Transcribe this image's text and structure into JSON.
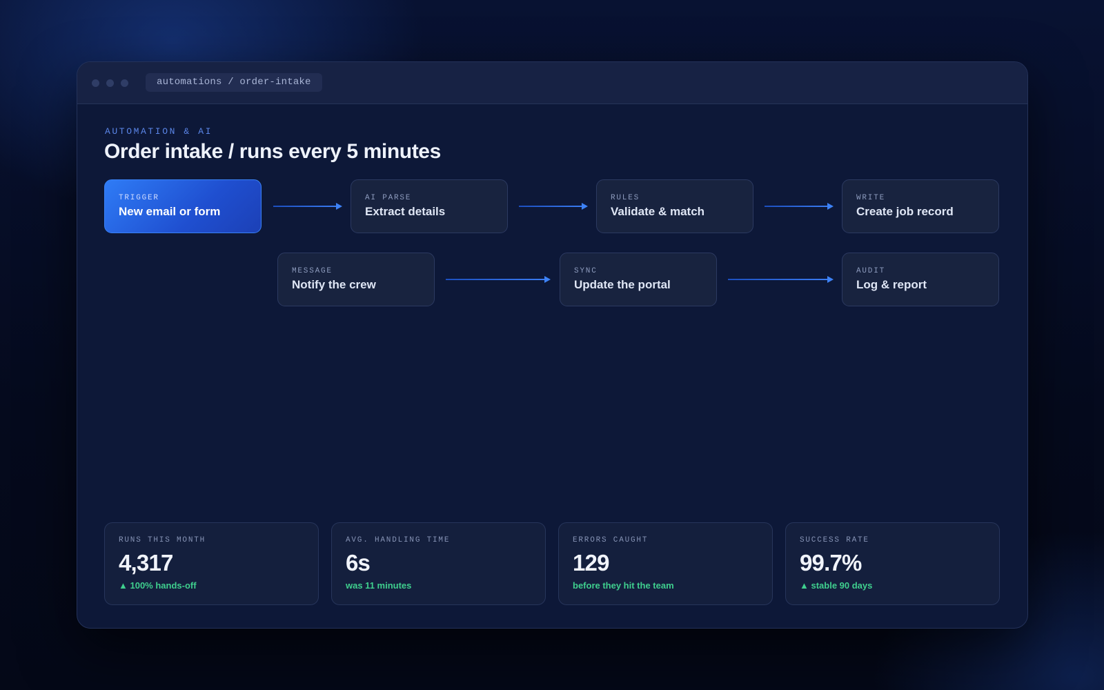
{
  "window": {
    "path": "automations / order-intake"
  },
  "header": {
    "eyebrow": "AUTOMATION & AI",
    "title": "Order intake / runs every 5 minutes"
  },
  "flow": {
    "nodes": [
      {
        "kicker": "TRIGGER",
        "label": "New email or form",
        "active": true
      },
      {
        "kicker": "AI PARSE",
        "label": "Extract details"
      },
      {
        "kicker": "RULES",
        "label": "Validate & match"
      },
      {
        "kicker": "WRITE",
        "label": "Create job record"
      },
      {
        "kicker": "MESSAGE",
        "label": "Notify the crew"
      },
      {
        "kicker": "SYNC",
        "label": "Update the portal"
      },
      {
        "kicker": "AUDIT",
        "label": "Log & report"
      }
    ]
  },
  "stats": [
    {
      "label": "RUNS THIS MONTH",
      "value": "4,317",
      "note": "▲ 100% hands-off"
    },
    {
      "label": "AVG. HANDLING TIME",
      "value": "6s",
      "note": "was 11 minutes"
    },
    {
      "label": "ERRORS CAUGHT",
      "value": "129",
      "note": "before they hit the team"
    },
    {
      "label": "SUCCESS RATE",
      "value": "99.7%",
      "note": "▲ stable 90 days"
    }
  ],
  "colors": {
    "accent": "#2f7cf6",
    "positive": "#3fcf8e",
    "background": "#0d1838"
  }
}
